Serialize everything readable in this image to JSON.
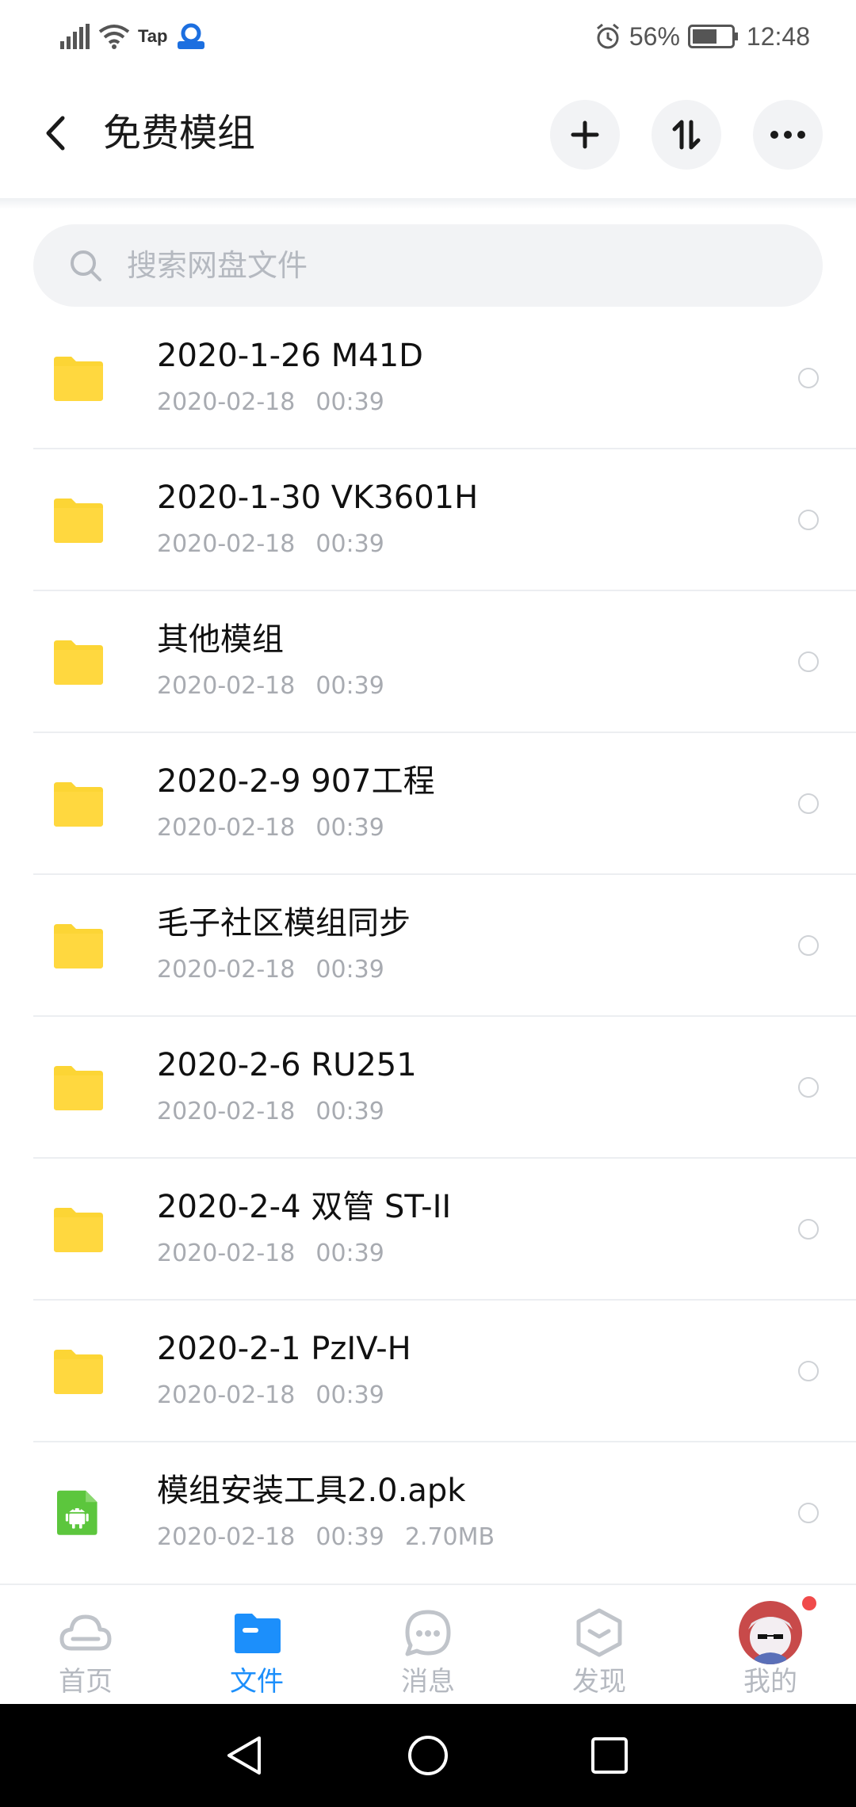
{
  "status_bar": {
    "carrier_label": "Tap",
    "battery": "56%",
    "time": "12:48"
  },
  "header": {
    "title": "免费模组"
  },
  "search": {
    "placeholder": "搜索网盘文件"
  },
  "files": [
    {
      "name": "2020-1-26 M41D",
      "date": "2020-02-18",
      "time": "00:39",
      "size": "",
      "type": "folder"
    },
    {
      "name": "2020-1-30 VK3601H",
      "date": "2020-02-18",
      "time": "00:39",
      "size": "",
      "type": "folder"
    },
    {
      "name": "其他模组",
      "date": "2020-02-18",
      "time": "00:39",
      "size": "",
      "type": "folder"
    },
    {
      "name": "2020-2-9 907工程",
      "date": "2020-02-18",
      "time": "00:39",
      "size": "",
      "type": "folder"
    },
    {
      "name": "毛子社区模组同步",
      "date": "2020-02-18",
      "time": "00:39",
      "size": "",
      "type": "folder"
    },
    {
      "name": "2020-2-6 RU251",
      "date": "2020-02-18",
      "time": "00:39",
      "size": "",
      "type": "folder"
    },
    {
      "name": "2020-2-4 双管 ST-II",
      "date": "2020-02-18",
      "time": "00:39",
      "size": "",
      "type": "folder"
    },
    {
      "name": "2020-2-1 PzIV-H",
      "date": "2020-02-18",
      "time": "00:39",
      "size": "",
      "type": "folder"
    },
    {
      "name": "模组安装工具2.0.apk",
      "date": "2020-02-18",
      "time": "00:39",
      "size": "2.70MB",
      "type": "apk"
    }
  ],
  "tabs": {
    "home": "首页",
    "files": "文件",
    "messages": "消息",
    "discover": "发现",
    "me": "我的"
  },
  "colors": {
    "accent": "#1c8ffb",
    "folder": "#fcd535",
    "apk": "#5cc63d",
    "badge": "#f04a4a"
  }
}
